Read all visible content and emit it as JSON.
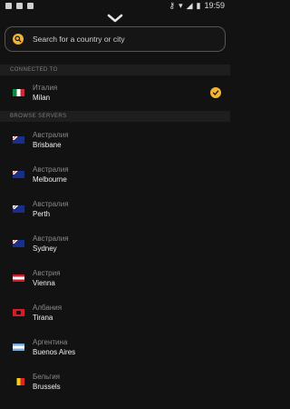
{
  "status_bar": {
    "time": "19:59"
  },
  "search": {
    "placeholder": "Search for a country or city"
  },
  "sections": {
    "connected": {
      "title": "CONNECTED TO"
    },
    "browse": {
      "title": "BROWSE SERVERS"
    }
  },
  "connected_server": {
    "country": "Италия",
    "city": "Milan",
    "flag": "flag-italy"
  },
  "servers": [
    {
      "country": "Австралия",
      "city": "Brisbane",
      "flag": "flag-australia"
    },
    {
      "country": "Австралия",
      "city": "Melbourne",
      "flag": "flag-australia"
    },
    {
      "country": "Австралия",
      "city": "Perth",
      "flag": "flag-australia"
    },
    {
      "country": "Австралия",
      "city": "Sydney",
      "flag": "flag-australia"
    },
    {
      "country": "Австрия",
      "city": "Vienna",
      "flag": "flag-austria"
    },
    {
      "country": "Албания",
      "city": "Tirana",
      "flag": "flag-albania"
    },
    {
      "country": "Аргентина",
      "city": "Buenos Aires",
      "flag": "flag-argentina"
    },
    {
      "country": "Бельгия",
      "city": "Brussels",
      "flag": "flag-belgium"
    }
  ],
  "colors": {
    "accent": "#f2b233",
    "background": "#121212"
  }
}
